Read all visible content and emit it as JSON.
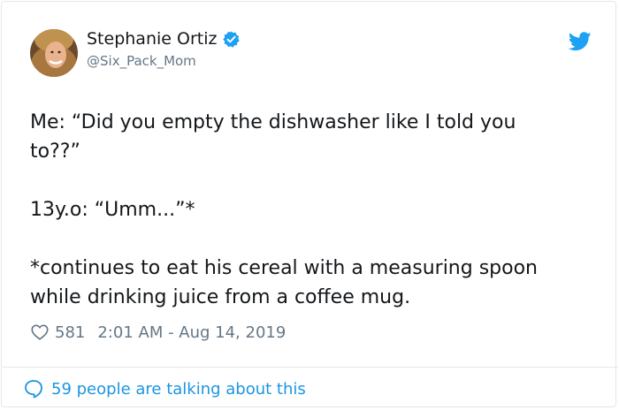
{
  "tweet": {
    "author_name": "Stephanie Ortiz",
    "author_handle": "@Six_Pack_Mom",
    "text": "Me: “Did you empty the dishwasher like I told you\nto??”\n\n13y.o: “Umm...”*\n\n*continues to eat his cereal with a measuring spoon\nwhile drinking juice from a coffee mug.",
    "likes": "581",
    "timestamp": "2:01 AM - Aug 14, 2019"
  },
  "footer": {
    "talking_label": "59 people are talking about this"
  },
  "icons": {
    "verified": "verified-badge-icon",
    "twitter": "twitter-bird-icon",
    "like": "heart-icon",
    "reply": "speech-bubble-icon"
  },
  "colors": {
    "accent": "#1da1f2",
    "link": "#1b95e0",
    "text": "#14171a",
    "muted": "#657786",
    "border": "#e1e8ed"
  }
}
